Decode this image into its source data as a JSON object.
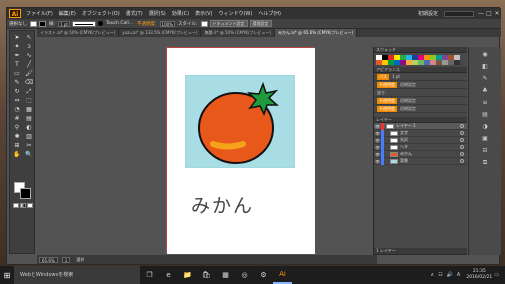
{
  "menubar": {
    "logo": "Ai",
    "items": [
      "ファイル(F)",
      "編集(E)",
      "オブジェクト(O)",
      "書式(T)",
      "選択(S)",
      "効果(C)",
      "表示(V)",
      "ウィンドウ(W)",
      "ヘルプ(H)"
    ],
    "workspace": "初期設定",
    "minimize": "—",
    "maximize": "□",
    "close": "✕"
  },
  "controlbar": {
    "selection_label": "選択なし",
    "stroke_label": "線:",
    "stroke_value": "1 pt",
    "brush_name": "Touch Call...",
    "opacity_label": "不透明度:",
    "opacity_value": "100%",
    "style_label": "スタイル:",
    "doc_setup": "ドキュメント設定",
    "env_setup": "環境設定"
  },
  "tabs": [
    {
      "label": "イラスト.ai* @ 50% (CMYK/プレビュー)",
      "active": false
    },
    {
      "label": "yuzu.ai* @ 133.5% (CMYK/プレビュー)",
      "active": false
    },
    {
      "label": "無題-1* @ 50% (CMYK/プレビュー)",
      "active": false
    },
    {
      "label": "みかん.ai* @ 65.6% (CMYK/プレビュー)",
      "active": true
    }
  ],
  "canvas": {
    "artwork_text": "みかん",
    "colors": {
      "orange": "#e8581a",
      "leaf": "#1f9a3c",
      "highlight": "#f7a21b",
      "sky": "#a9dde6"
    }
  },
  "statusbar": {
    "zoom": "65.6%",
    "page": "1",
    "status_text": "選択"
  },
  "panels": {
    "swatches_title": "スウォッチ",
    "appearance_title": "アピアランス",
    "appearance_rows": [
      {
        "tag": "パス",
        "value": "1 pt"
      },
      {
        "tag": "不透明度",
        "value": "初期設定"
      },
      {
        "tag": "塗り:",
        "value": ""
      },
      {
        "tag": "不透明度",
        "value": "初期設定"
      },
      {
        "tag": "不透明度",
        "value": "初期設定"
      }
    ],
    "layers_title": "レイヤー",
    "layers": [
      {
        "name": "レイヤー 1",
        "indent": 0
      },
      {
        "name": "文字",
        "indent": 1
      },
      {
        "name": "光沢",
        "indent": 1
      },
      {
        "name": "ヘタ",
        "indent": 1
      },
      {
        "name": "みかん",
        "indent": 1
      },
      {
        "name": "背景",
        "indent": 1
      }
    ],
    "layers_footer": "1 レイヤー"
  },
  "taskbar": {
    "search_placeholder": "WebとWindowsを検索",
    "time": "21:35",
    "date": "2016/02/21"
  }
}
